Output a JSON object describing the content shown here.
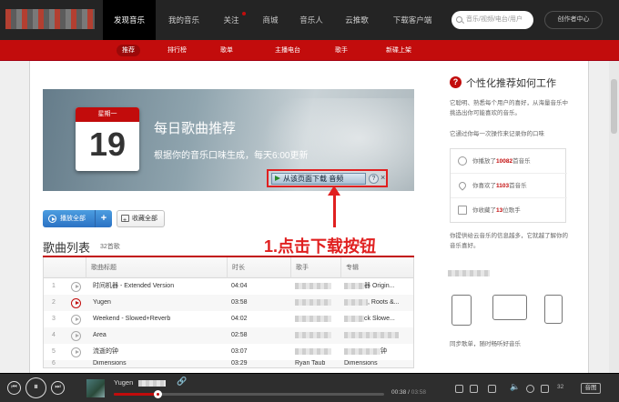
{
  "topnav": {
    "items": [
      "发现音乐",
      "我的音乐",
      "关注",
      "商城",
      "音乐人",
      "云推歌",
      "下载客户端"
    ],
    "search_placeholder": "音乐/视频/电台/用户",
    "creator_label": "创作者中心"
  },
  "subnav": {
    "items": [
      "推荐",
      "排行榜",
      "歌单",
      "主播电台",
      "歌手",
      "新碟上架"
    ]
  },
  "banner": {
    "weekday": "星期一",
    "day": "19",
    "title": "每日歌曲推荐",
    "subtitle": "根据你的音乐口味生成，每天6:00更新",
    "download_label": "从该页面下载 音频",
    "download_help": "?",
    "download_close": "×"
  },
  "annotation": "1.点击下载按钮",
  "actions": {
    "play_all": "播放全部",
    "add": "+",
    "collect_all": "收藏全部"
  },
  "songlist": {
    "title": "歌曲列表",
    "count": "32首歌",
    "headers": [
      "歌曲标题",
      "时长",
      "歌手",
      "专辑"
    ],
    "rows": [
      {
        "num": "1",
        "title": "时间机器 - Extended Version",
        "duration": "04:04",
        "artist": "",
        "album": "器 Origin..."
      },
      {
        "num": "2",
        "title": "Yugen",
        "duration": "03:58",
        "artist": "",
        "album": ", Roots &..."
      },
      {
        "num": "3",
        "title": "Weekend - Slowed+Reverb",
        "duration": "04:02",
        "artist": "",
        "album": "ck Slowe..."
      },
      {
        "num": "4",
        "title": "Area",
        "duration": "02:58",
        "artist": "",
        "album": ""
      },
      {
        "num": "5",
        "title": "流逝的钟",
        "duration": "03:07",
        "artist": "",
        "album": "钟"
      },
      {
        "num": "6",
        "title": "Dimensions",
        "duration": "03:29",
        "artist": "Ryan Taub",
        "album": "Dimensions"
      }
    ]
  },
  "sidebar": {
    "title": "个性化推荐如何工作",
    "para1": "它聪明、熟悉每个用户的喜好，从海量音乐中挑选出你可能喜欢的音乐。",
    "para2": "它通过你每一次操作来记录你的口味",
    "stats": [
      {
        "pre": "你播放了",
        "num": "10082",
        "post": "首音乐"
      },
      {
        "pre": "你喜欢了",
        "num": "1103",
        "post": "首音乐"
      },
      {
        "pre": "你收藏了",
        "num": "13",
        "post": "位歌手"
      }
    ],
    "para3": "你提供给云音乐的信息越多，它就越了解你的音乐喜好。",
    "sync": "同步歌单，随时畅听好音乐"
  },
  "player": {
    "song": "Yugen",
    "current_time": "00:38",
    "total_time": "03:58",
    "volume_num": "32",
    "lyric_label": "音图",
    "progress": 0.16
  }
}
